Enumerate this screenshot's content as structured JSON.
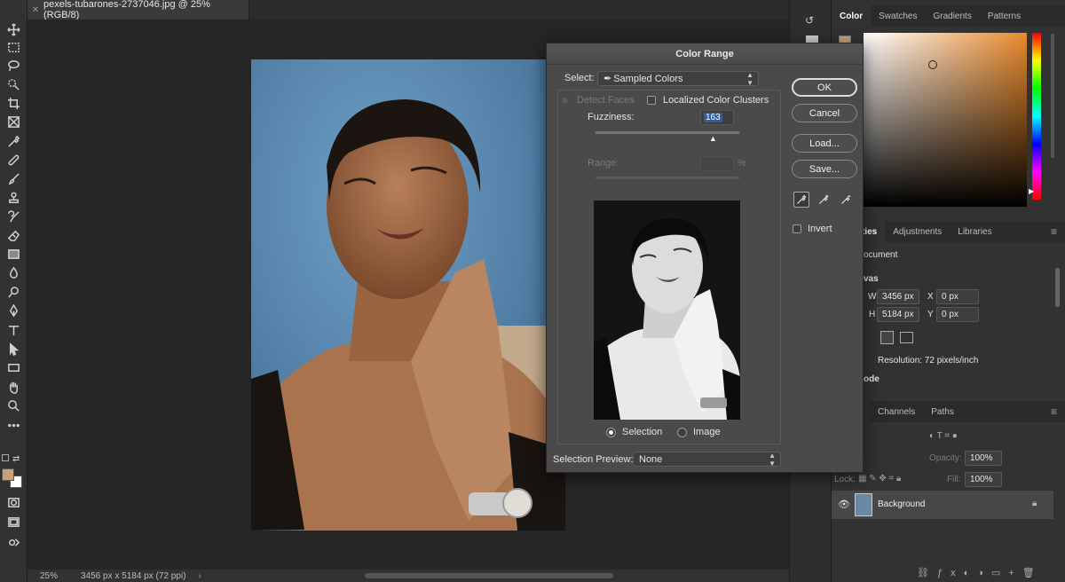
{
  "document": {
    "tab_title": "pexels-tubarones-2737046.jpg @ 25% (RGB/8)",
    "zoom": "25%",
    "dimensions_status": "3456 px x 5184 px (72 ppi)"
  },
  "colors": {
    "foreground": "#c9a07c",
    "background": "#ffffff",
    "dialog_bg": "#4a4a4a",
    "panel_bg": "#323232",
    "photo_bg": "#5b87ad"
  },
  "tools": [
    "move-icon",
    "marquee-icon",
    "lasso-icon",
    "quick-select-icon",
    "crop-icon",
    "frame-icon",
    "eyedropper-icon",
    "healing-icon",
    "brush-icon",
    "stamp-icon",
    "history-brush-icon",
    "eraser-icon",
    "gradient-icon",
    "blur-icon",
    "dodge-icon",
    "pen-icon",
    "type-icon",
    "path-select-icon",
    "rectangle-icon",
    "hand-icon",
    "zoom-icon",
    "more-icon"
  ],
  "color_panel": {
    "tabs": [
      "Color",
      "Swatches",
      "Gradients",
      "Patterns"
    ]
  },
  "properties_panel": {
    "tabs": [
      "ties",
      "Adjustments",
      "Libraries"
    ],
    "document_label": "ocument",
    "canvas_label": "vas",
    "width_label": "W",
    "width_value": "3456 px",
    "x_label": "X",
    "x_value": "0 px",
    "height_label": "H",
    "height_value": "5184 px",
    "y_label": "Y",
    "y_value": "0 px",
    "resolution": "Resolution: 72 pixels/inch",
    "mode_label": "ode"
  },
  "layers_panel": {
    "tabs": [
      "Channels",
      "Paths"
    ],
    "opacity_label": "Opacity:",
    "opacity_value": "100%",
    "lock_label": "Lock:",
    "fill_label": "Fill:",
    "fill_value": "100%",
    "layer_name": "Background"
  },
  "color_range": {
    "title": "Color Range",
    "select_label": "Select:",
    "select_value": "Sampled Colors",
    "detect_faces": "Detect Faces",
    "localized": "Localized Color Clusters",
    "fuzziness_label": "Fuzziness:",
    "fuzziness_value": "163",
    "fuzziness_max": 200,
    "range_label": "Range:",
    "range_unit": "%",
    "buttons": {
      "ok": "OK",
      "cancel": "Cancel",
      "load": "Load...",
      "save": "Save..."
    },
    "invert": "Invert",
    "view_selection": "Selection",
    "view_image": "Image",
    "preview_label": "Selection Preview:",
    "preview_value": "None"
  }
}
